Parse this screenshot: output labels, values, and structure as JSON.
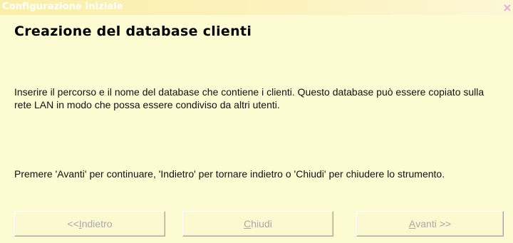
{
  "window": {
    "title": "Configurazione iniziale",
    "close_glyph": "×"
  },
  "content": {
    "heading": "Creazione del database clienti",
    "paragraph1": "Inserire il percorso e il nome del database che contiene i clienti. Questo database può essere copiato sulla rete LAN in modo che possa essere condiviso da altri utenti.",
    "paragraph2": "Premere 'Avanti' per continuare, 'Indietro' per tornare indietro o 'Chiudi' per chiudere lo strumento."
  },
  "buttons": {
    "back": {
      "prefix": "<< ",
      "mnemonic": "I",
      "rest": "ndietro"
    },
    "close": {
      "prefix": "",
      "mnemonic": "C",
      "rest": "hiudi"
    },
    "next": {
      "prefix": "",
      "mnemonic": "A",
      "rest": "vanti >>"
    }
  },
  "colors": {
    "background": "#FDFBD1",
    "titlebar": "#FAEFA9",
    "disabled_text": "#A9A9A9",
    "close_icon": "#E9A9D9"
  }
}
